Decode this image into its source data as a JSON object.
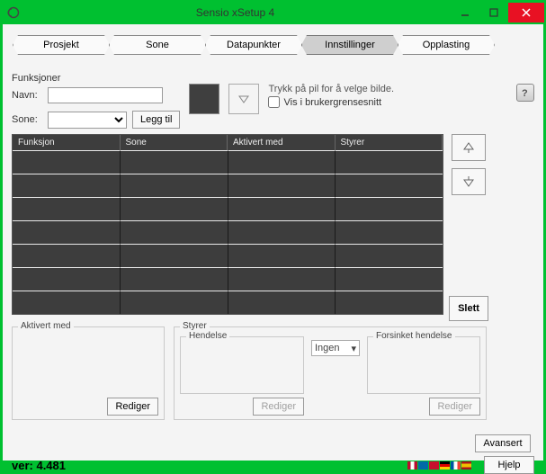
{
  "window": {
    "title": "Sensio xSetup 4"
  },
  "tabs": {
    "project": "Prosjekt",
    "zone": "Sone",
    "datapoints": "Datapunkter",
    "settings": "Innstillinger",
    "upload": "Opplasting",
    "active": "settings"
  },
  "section_title": "Funksjoner",
  "form": {
    "name_label": "Navn:",
    "name_value": "",
    "zone_label": "Sone:",
    "zone_value": "",
    "add_btn": "Legg til",
    "hint": "Trykk på pil for å velge bilde.",
    "checkbox_label": "Vis i brukergrensesnitt"
  },
  "table": {
    "headers": {
      "func": "Funksjon",
      "zone": "Sone",
      "activ": "Aktivert med",
      "ctrl": "Styrer"
    }
  },
  "side": {
    "delete_btn": "Slett"
  },
  "groups": {
    "aktivert": {
      "title": "Aktivert med",
      "edit": "Rediger"
    },
    "styrer": {
      "title": "Styrer",
      "hendelse": {
        "title": "Hendelse",
        "edit": "Rediger"
      },
      "delay_select": "Ingen",
      "forsinket": {
        "title": "Forsinket hendelse",
        "edit": "Rediger"
      }
    }
  },
  "advanced_btn": "Avansert",
  "version_label": "ver: 4.481",
  "help_btn": "Hjelp"
}
